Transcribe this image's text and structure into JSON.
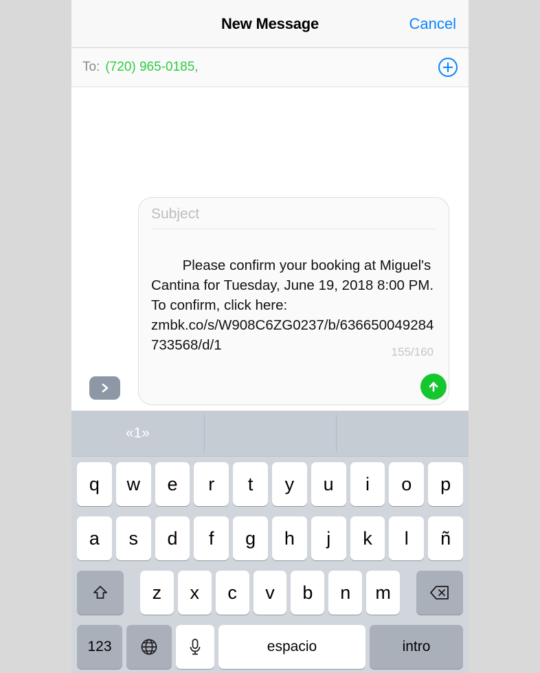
{
  "navbar": {
    "title": "New Message",
    "cancel_label": "Cancel"
  },
  "recipients": {
    "to_label": "To:",
    "value": "(720) 965-0185",
    "separator": ",",
    "value_color": "#2ecc40",
    "add_icon": "add-contact-plus-icon"
  },
  "composer": {
    "expand_icon": "chevron-right-icon",
    "subject_placeholder": "Subject",
    "body_text": "Please confirm your booking at Miguel's Cantina for Tuesday, June 19, 2018 8:00 PM. To confirm, click here: zmbk.co/s/W908C6ZG0237/b/636650049284733568/d/1",
    "char_count": "155/160",
    "send_icon": "send-arrow-up-icon",
    "send_color": "#16c62e"
  },
  "predictive_bar": {
    "suggestions": [
      "«1»",
      "",
      ""
    ]
  },
  "keyboard": {
    "language": "es",
    "row1": [
      "q",
      "w",
      "e",
      "r",
      "t",
      "y",
      "u",
      "i",
      "o",
      "p"
    ],
    "row2": [
      "a",
      "s",
      "d",
      "f",
      "g",
      "h",
      "j",
      "k",
      "l",
      "ñ"
    ],
    "row3": [
      "z",
      "x",
      "c",
      "v",
      "b",
      "n",
      "m"
    ],
    "shift_icon": "shift-arrow-up-icon",
    "backspace_icon": "backspace-delete-icon",
    "numeric_label": "123",
    "globe_icon": "globe-language-icon",
    "mic_icon": "microphone-icon",
    "space_label": "espacio",
    "return_label": "intro"
  }
}
